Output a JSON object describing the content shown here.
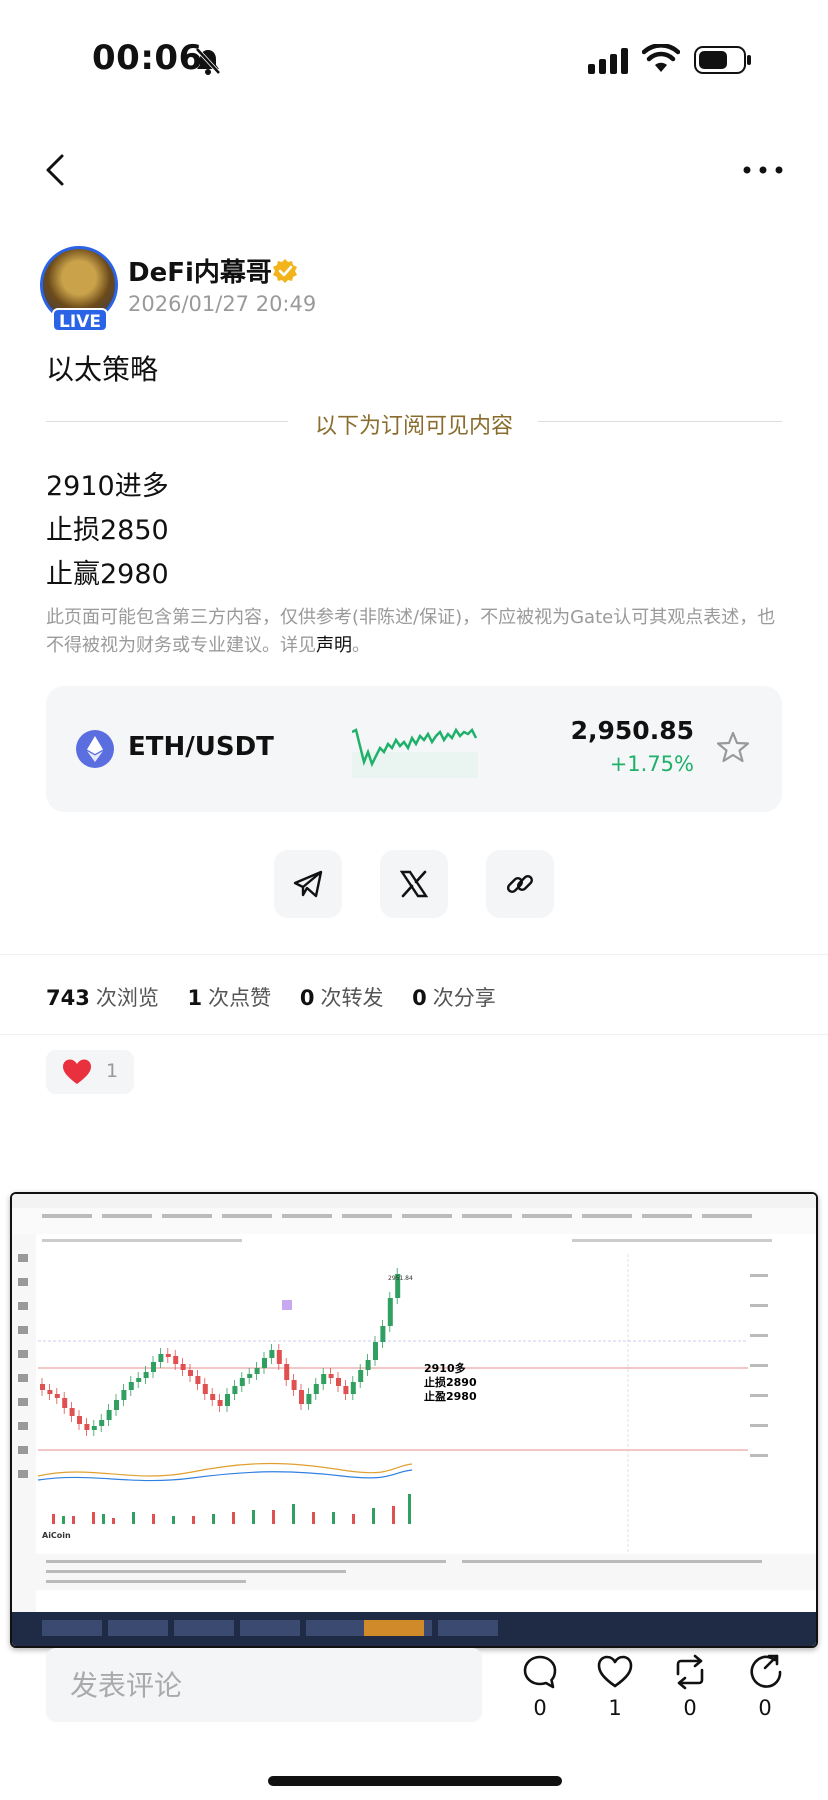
{
  "status_bar": {
    "time": "00:06"
  },
  "author": {
    "name": "DeFi内幕哥",
    "live_badge": "LIVE",
    "date": "2026/01/27 20:49"
  },
  "post": {
    "title": "以太策略",
    "divider_text": "以下为订阅可见内容",
    "lines": [
      "2910进多",
      "止损2850",
      "止赢2980"
    ],
    "disclaimer": "此页面可能包含第三方内容，仅供参考(非陈述/保证)，不应被视为Gate认可其观点表述，也不得被视为财务或专业建议。详见",
    "disclaimer_link": "声明",
    "disclaimer_end": "。"
  },
  "ticker": {
    "pair": "ETH/USDT",
    "price": "2,950.85",
    "change": "+1.75%"
  },
  "stats": {
    "views": "743",
    "views_label": "次浏览",
    "likes": "1",
    "likes_label": "次点赞",
    "reposts": "0",
    "reposts_label": "次转发",
    "shares": "0",
    "shares_label": "次分享"
  },
  "reaction": {
    "count": "1"
  },
  "image_overlay": {
    "line1": "2910多",
    "line2": "止损2890",
    "line3": "止盈2980",
    "price_label": "2951.84",
    "brand": "AiCoin"
  },
  "bottom_bar": {
    "comment_placeholder": "发表评论",
    "comments": "0",
    "likes": "1",
    "reposts": "0",
    "shares": "0"
  },
  "colors": {
    "accent": "#2b63e6",
    "up": "#1fb06a",
    "gold": "#8a6d2e"
  }
}
